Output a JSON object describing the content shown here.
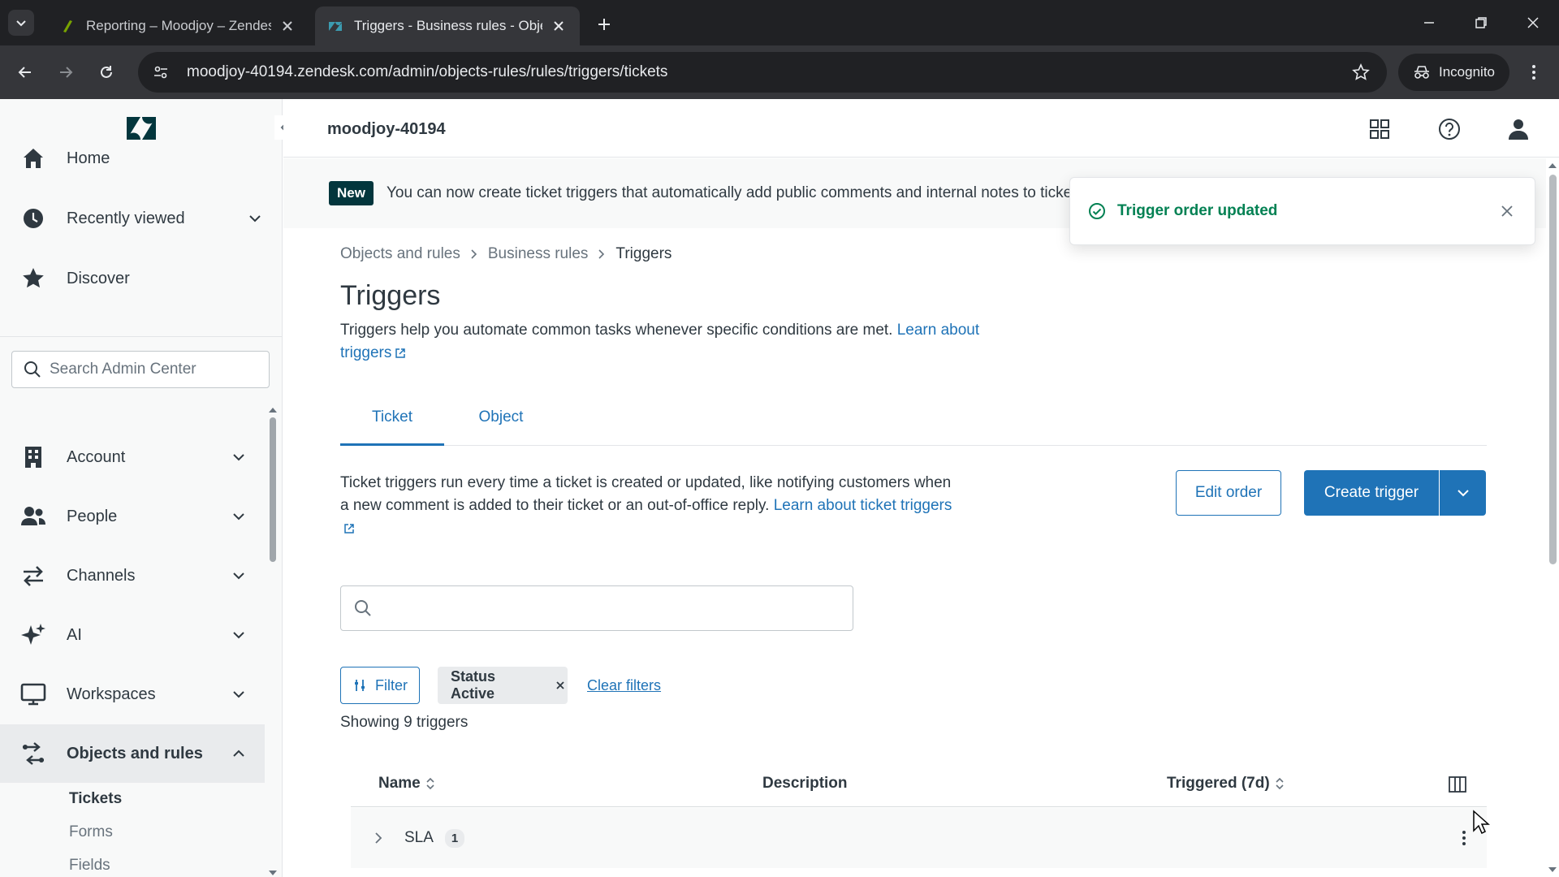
{
  "browser": {
    "tabs": [
      {
        "title": "Reporting – Moodjoy – Zendesk",
        "active": false
      },
      {
        "title": "Triggers - Business rules - Objects and rules",
        "active": true
      }
    ],
    "url": "moodjoy-40194.zendesk.com/admin/objects-rules/rules/triggers/tickets",
    "incognito_label": "Incognito"
  },
  "sidebar": {
    "top_items": [
      {
        "label": "Home",
        "icon": "home-icon"
      },
      {
        "label": "Recently viewed",
        "icon": "clock-icon"
      },
      {
        "label": "Discover",
        "icon": "star-icon"
      }
    ],
    "search_placeholder": "Search Admin Center",
    "sections": [
      {
        "label": "Account",
        "icon": "building-icon"
      },
      {
        "label": "People",
        "icon": "people-icon"
      },
      {
        "label": "Channels",
        "icon": "arrows-icon"
      },
      {
        "label": "AI",
        "icon": "sparkle-icon"
      },
      {
        "label": "Workspaces",
        "icon": "monitor-icon"
      },
      {
        "label": "Objects and rules",
        "icon": "objects-rules-icon",
        "expanded": true
      }
    ],
    "sub_items": [
      "Tickets",
      "Forms",
      "Fields"
    ]
  },
  "header": {
    "org": "moodjoy-40194"
  },
  "banner": {
    "badge": "New",
    "text": "You can now create ticket triggers that automatically add public comments and internal notes to tickets."
  },
  "toast": {
    "message": "Trigger order updated"
  },
  "breadcrumb": [
    "Objects and rules",
    "Business rules",
    "Triggers"
  ],
  "page": {
    "title": "Triggers",
    "description": "Triggers help you automate common tasks whenever specific conditions are met.",
    "learn_link": "Learn about triggers"
  },
  "tabs": [
    "Ticket",
    "Object"
  ],
  "ticket_section": {
    "description": "Ticket triggers run every time a ticket is created or updated, like notifying customers when a new comment is added to their ticket or an out-of-office reply.",
    "learn_link": "Learn about ticket triggers",
    "edit_order": "Edit order",
    "create_trigger": "Create trigger"
  },
  "filters": {
    "filter_label": "Filter",
    "active_chip": "Status Active",
    "clear_label": "Clear filters"
  },
  "showing": "Showing 9 triggers",
  "table": {
    "columns": [
      "Name",
      "Description",
      "Triggered (7d)"
    ],
    "rows": [
      {
        "name": "SLA",
        "count": "1"
      }
    ]
  },
  "colors": {
    "accent": "#1f73b7",
    "success": "#038153",
    "badge_bg": "#03363d"
  }
}
